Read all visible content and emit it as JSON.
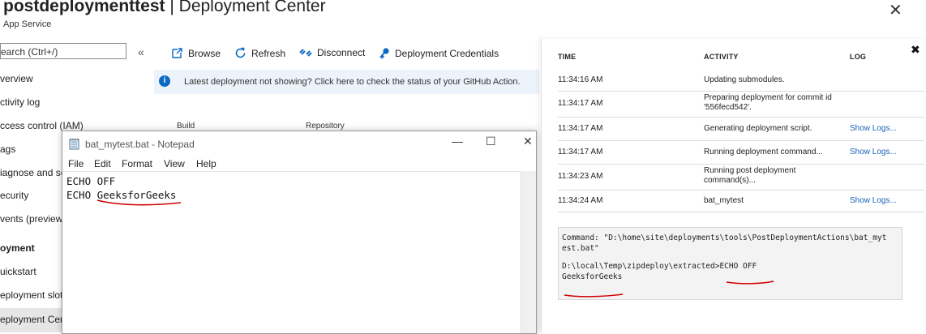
{
  "header": {
    "title_bold": "postdeploymenttest",
    "title_rest": " | Deployment Center",
    "subtitle": "App Service",
    "close_glyph": "✕"
  },
  "sidebar": {
    "search_placeholder": "earch (Ctrl+/)",
    "collapse_glyph": "«",
    "items": [
      {
        "label": "verview"
      },
      {
        "label": "ctivity log"
      },
      {
        "label": "ccess control (IAM)"
      },
      {
        "label": "ags"
      },
      {
        "label": "iagnose and so"
      },
      {
        "label": "ecurity"
      },
      {
        "label": "vents (preview)"
      }
    ],
    "section": "oyment",
    "items2": [
      {
        "label": "uickstart"
      },
      {
        "label": "eployment slot"
      },
      {
        "label": "eployment Cen"
      }
    ]
  },
  "toolbar": {
    "browse": "Browse",
    "refresh": "Refresh",
    "disconnect": "Disconnect",
    "credentials": "Deployment Credentials"
  },
  "info_bar": {
    "text": "Latest deployment not showing? Click here to check the status of your GitHub Action."
  },
  "columns": {
    "build": "Build",
    "repository": "Repository"
  },
  "log_panel": {
    "headers": {
      "time": "TIME",
      "activity": "ACTIVITY",
      "log": "LOG"
    },
    "close_glyph": "✖",
    "rows": [
      {
        "time": "11:34:16 AM",
        "activity": "Updating submodules.",
        "log": ""
      },
      {
        "time": "11:34:17 AM",
        "activity": "Preparing deployment for commit id '556fecd542'.",
        "log": ""
      },
      {
        "time": "11:34:17 AM",
        "activity": "Generating deployment script.",
        "log": "Show Logs..."
      },
      {
        "time": "11:34:17 AM",
        "activity": "Running deployment command...",
        "log": "Show Logs..."
      },
      {
        "time": "11:34:23 AM",
        "activity": "Running post deployment command(s)...",
        "log": ""
      },
      {
        "time": "11:34:24 AM",
        "activity": "bat_mytest",
        "log": "Show Logs..."
      }
    ],
    "output": {
      "line1": "Command: \"D:\\home\\site\\deployments\\tools\\PostDeploymentActions\\bat_myt",
      "line2": "est.bat\"",
      "line3": "D:\\local\\Temp\\zipdeploy\\extracted>ECHO OFF",
      "line4": "GeeksforGeeks"
    }
  },
  "notepad": {
    "title": "bat_mytest.bat - Notepad",
    "menu": [
      "File",
      "Edit",
      "Format",
      "View",
      "Help"
    ],
    "lines": [
      "ECHO OFF",
      "ECHO GeeksforGeeks"
    ],
    "min_glyph": "—",
    "max_glyph": "☐",
    "close_glyph": "✕"
  },
  "colors": {
    "accent": "#0b6ac4",
    "link": "#1a63b8",
    "annotation": "#d00000"
  }
}
